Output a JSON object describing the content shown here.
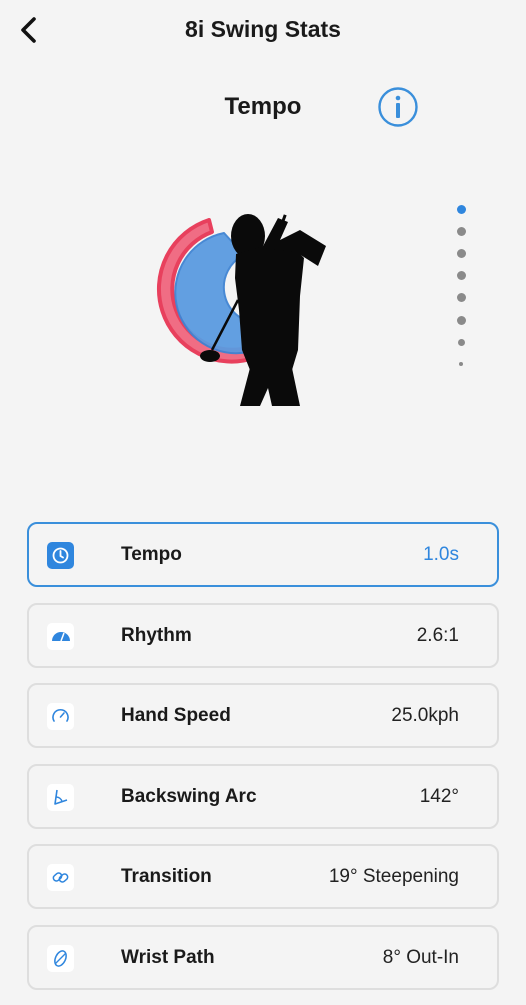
{
  "header": {
    "title": "8i Swing Stats",
    "back_icon": "chevron-left-icon"
  },
  "section": {
    "title": "Tempo",
    "info_icon": "info-circle-icon"
  },
  "pager": {
    "total": 8,
    "active_index": 0
  },
  "colors": {
    "accent": "#2f86de",
    "arc_outer": "#e8405d",
    "arc_inner": "#5b9be0"
  },
  "stats": [
    {
      "label": "Tempo",
      "value": "1.0s",
      "icon": "clock-icon",
      "active": true
    },
    {
      "label": "Rhythm",
      "value": "2.6:1",
      "icon": "gauge-half-icon",
      "active": false
    },
    {
      "label": "Hand Speed",
      "value": "25.0kph",
      "icon": "speedometer-icon",
      "active": false
    },
    {
      "label": "Backswing Arc",
      "value": "142°",
      "icon": "arc-angle-icon",
      "active": false
    },
    {
      "label": "Transition",
      "value": "19° Steepening",
      "icon": "transition-loop-icon",
      "active": false
    },
    {
      "label": "Wrist Path",
      "value": "8° Out-In",
      "icon": "wrist-path-icon",
      "active": false
    }
  ]
}
